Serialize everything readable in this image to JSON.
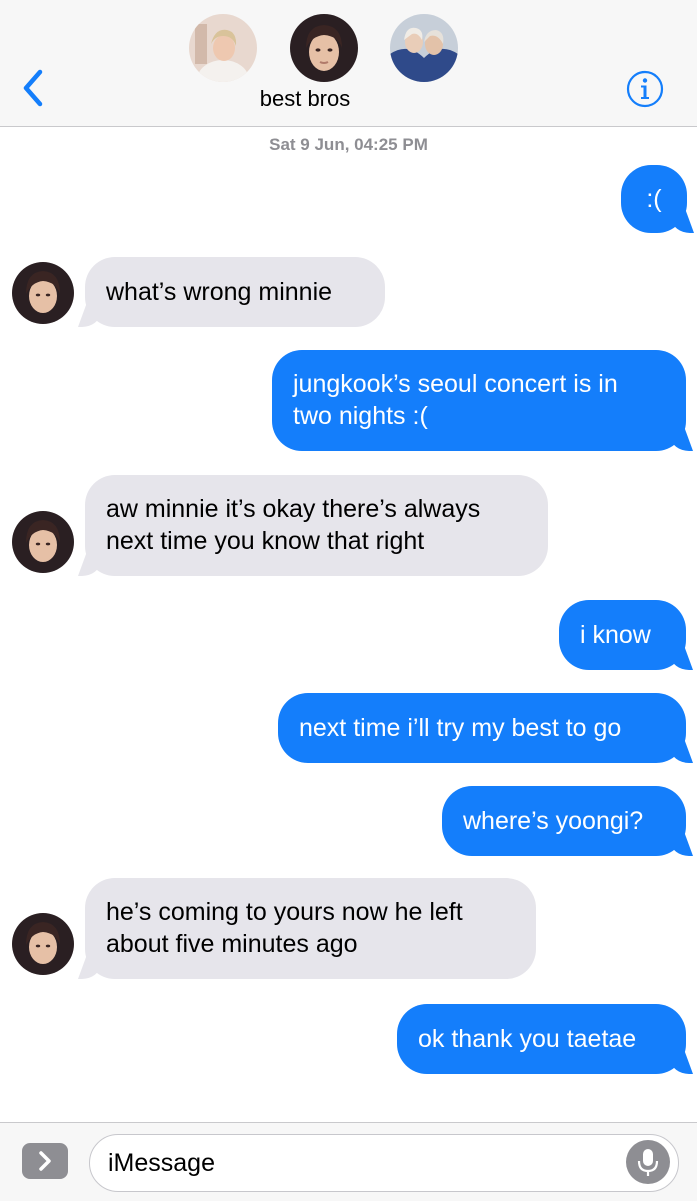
{
  "header": {
    "group_name": "best bros",
    "avatars": [
      "avatar-1",
      "avatar-2",
      "avatar-3"
    ],
    "back_icon": "chevron-left-icon",
    "info_icon": "info-icon",
    "accent_color": "#147efb"
  },
  "timestamp": "Sat 9 Jun, 04:25 PM",
  "messages": [
    {
      "side": "sent",
      "text": ":("
    },
    {
      "side": "received",
      "text": "what’s wrong minnie"
    },
    {
      "side": "sent",
      "text": "jungkook’s seoul concert is in\ntwo nights :("
    },
    {
      "side": "received",
      "text": "aw minnie it’s okay there’s always\nnext time you know that right"
    },
    {
      "side": "sent",
      "text": "i know"
    },
    {
      "side": "sent",
      "text": "next time i’ll try my best to go"
    },
    {
      "side": "sent",
      "text": "where’s yoongi?"
    },
    {
      "side": "received",
      "text": "he’s coming to yours now he left\nabout five minutes ago"
    },
    {
      "side": "sent",
      "text": "ok thank you taetae"
    }
  ],
  "composer": {
    "placeholder": "iMessage",
    "apps_icon": "chevron-right-icon",
    "mic_icon": "microphone-icon"
  },
  "colors": {
    "sent_bubble": "#147efb",
    "received_bubble": "#e6e5eb",
    "timestamp": "#8e8e93"
  }
}
